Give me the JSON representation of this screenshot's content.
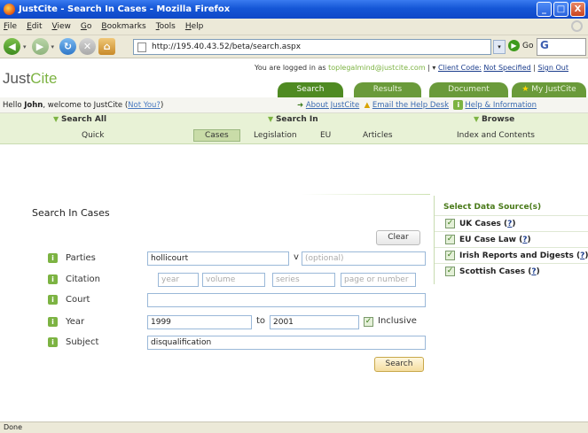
{
  "window": {
    "title": "JustCite - Search In Cases - Mozilla Firefox",
    "controls": [
      "_",
      "□",
      "X"
    ]
  },
  "menu": [
    "File",
    "Edit",
    "View",
    "Go",
    "Bookmarks",
    "Tools",
    "Help"
  ],
  "nav": {
    "url": "http://195.40.43.52/beta/search.aspx",
    "go_label": "Go",
    "search_engine_glyph": "G",
    "icons": [
      "back-arrow-icon",
      "forward-arrow-icon",
      "reload-icon",
      "stop-icon",
      "home-icon",
      "page-icon",
      "dropdown-icon"
    ]
  },
  "header": {
    "logo_prefix": "Just",
    "logo_suffix": "Cite",
    "logged_in_text": "You are logged in as",
    "email": "toplegalmind@justcite.com",
    "separator": " | ▾",
    "client_code_label": "Client Code:",
    "client_code_value": "Not Specified",
    "sign_out": "Sign Out",
    "tabs": [
      {
        "label": "Search",
        "active": true
      },
      {
        "label": "Results",
        "active": false
      },
      {
        "label": "Document",
        "active": false
      },
      {
        "label": "My JustCite",
        "active": false
      }
    ]
  },
  "welcome": {
    "hello": "Hello",
    "name": "John",
    "rest": ", welcome to JustCite (",
    "not_you": "Not You?",
    "close_paren": ")",
    "about": "About JustCite",
    "email_help": "Email the Help Desk",
    "help_info": "Help & Information"
  },
  "categories": {
    "search_all": "Search All",
    "search_in": "Search In",
    "browse": "Browse",
    "items": [
      "Quick",
      "Cases",
      "Legislation",
      "EU",
      "Articles",
      "Index and Contents"
    ],
    "selected": "Cases"
  },
  "form": {
    "title": "Search In Cases",
    "clear_label": "Clear",
    "search_label": "Search",
    "parties_label": "Parties",
    "parties_value": "hollicourt",
    "parties_v": "v",
    "parties_optional_placeholder": "(optional)",
    "citation_label": "Citation",
    "citation_year_placeholder": "year",
    "citation_volume_placeholder": "volume",
    "citation_series_placeholder": "series",
    "citation_page_placeholder": "page or number",
    "court_label": "Court",
    "court_value": "",
    "year_label": "Year",
    "year_from": "1999",
    "year_to_label": "to",
    "year_to": "2001",
    "inclusive_label": "Inclusive",
    "inclusive_checked": true,
    "subject_label": "Subject",
    "subject_value": "disqualification"
  },
  "sources": {
    "title": "Select Data Source(s)",
    "items": [
      {
        "label": "UK Cases",
        "help": "?",
        "checked": true
      },
      {
        "label": "EU Case Law",
        "help": "?",
        "checked": true
      },
      {
        "label": "Irish Reports and Digests",
        "help": "?",
        "checked": true
      },
      {
        "label": "Scottish Cases",
        "help": "?",
        "checked": true
      }
    ]
  },
  "status": {
    "text": "Done"
  },
  "colors": {
    "brand_green": "#7cb342",
    "tab_green": "#6a9a3a",
    "link_blue": "#1a3c8c",
    "xp_blue": "#1556d6"
  }
}
